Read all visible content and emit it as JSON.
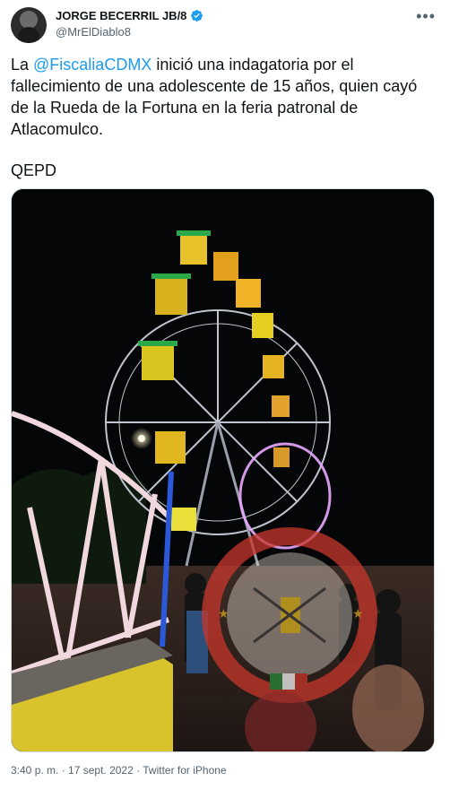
{
  "author": {
    "display_name": "JORGE BECERRIL JB/8",
    "handle": "@MrElDiablo8",
    "verified": true
  },
  "tweet": {
    "text_prefix": "La ",
    "mention": "@FiscaliaCDMX",
    "text_suffix": " inició una indagatoria por el fallecimiento de una adolescente de 15 años, quien cayó de la Rueda de la Fortuna en la feria patronal de Atlacomulco.",
    "closing": "QEPD"
  },
  "watermark": {
    "top_text": "H. CUERPO DE BOMBEROS",
    "bottom_text": "ATLACOMULCO MEX."
  },
  "meta": {
    "time": "3:40 p. m.",
    "separator1": " · ",
    "date": "17 sept. 2022",
    "separator2": " · ",
    "source": "Twitter for iPhone"
  },
  "colors": {
    "accent": "#1d9bf0",
    "text": "#0f1419",
    "muted": "#536471"
  },
  "icons": {
    "more": "more-icon",
    "verified": "verified-badge-icon"
  }
}
